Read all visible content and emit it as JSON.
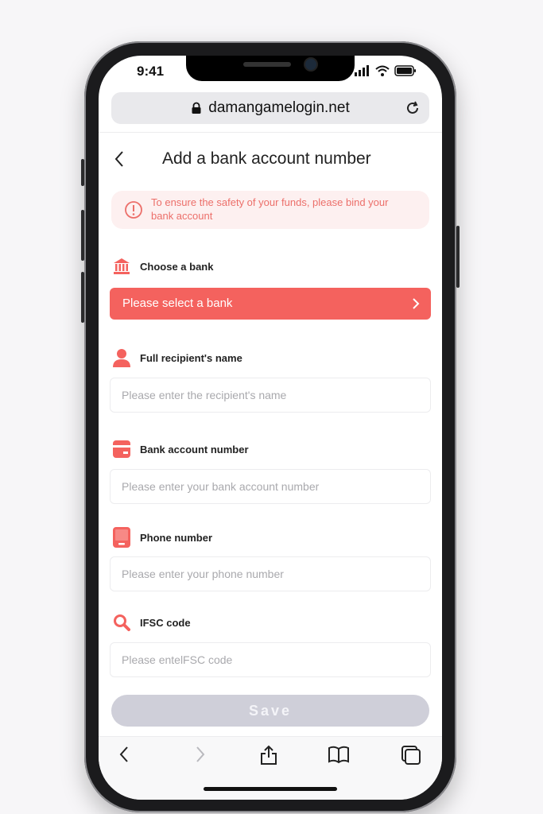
{
  "status_bar": {
    "time": "9:41"
  },
  "browser": {
    "url": "damangamelogin.net"
  },
  "header": {
    "title": "Add a bank account number"
  },
  "notice": {
    "text": "To ensure the safety of your funds, please bind your bank account"
  },
  "form": {
    "bank": {
      "label": "Choose a bank",
      "value": "Please select a bank"
    },
    "name": {
      "label": "Full recipient's name",
      "placeholder": "Please enter the recipient's name"
    },
    "account": {
      "label": "Bank account number",
      "placeholder": "Please enter your bank account number"
    },
    "phone": {
      "label": "Phone number",
      "placeholder": "Please enter your phone number"
    },
    "ifsc": {
      "label": "IFSC code",
      "placeholder": "Please entelFSC code"
    },
    "save_label": "Save"
  },
  "colors": {
    "accent": "#f4625e",
    "notice_text": "#ec6f6a",
    "save_disabled": "#cfcfd9"
  }
}
